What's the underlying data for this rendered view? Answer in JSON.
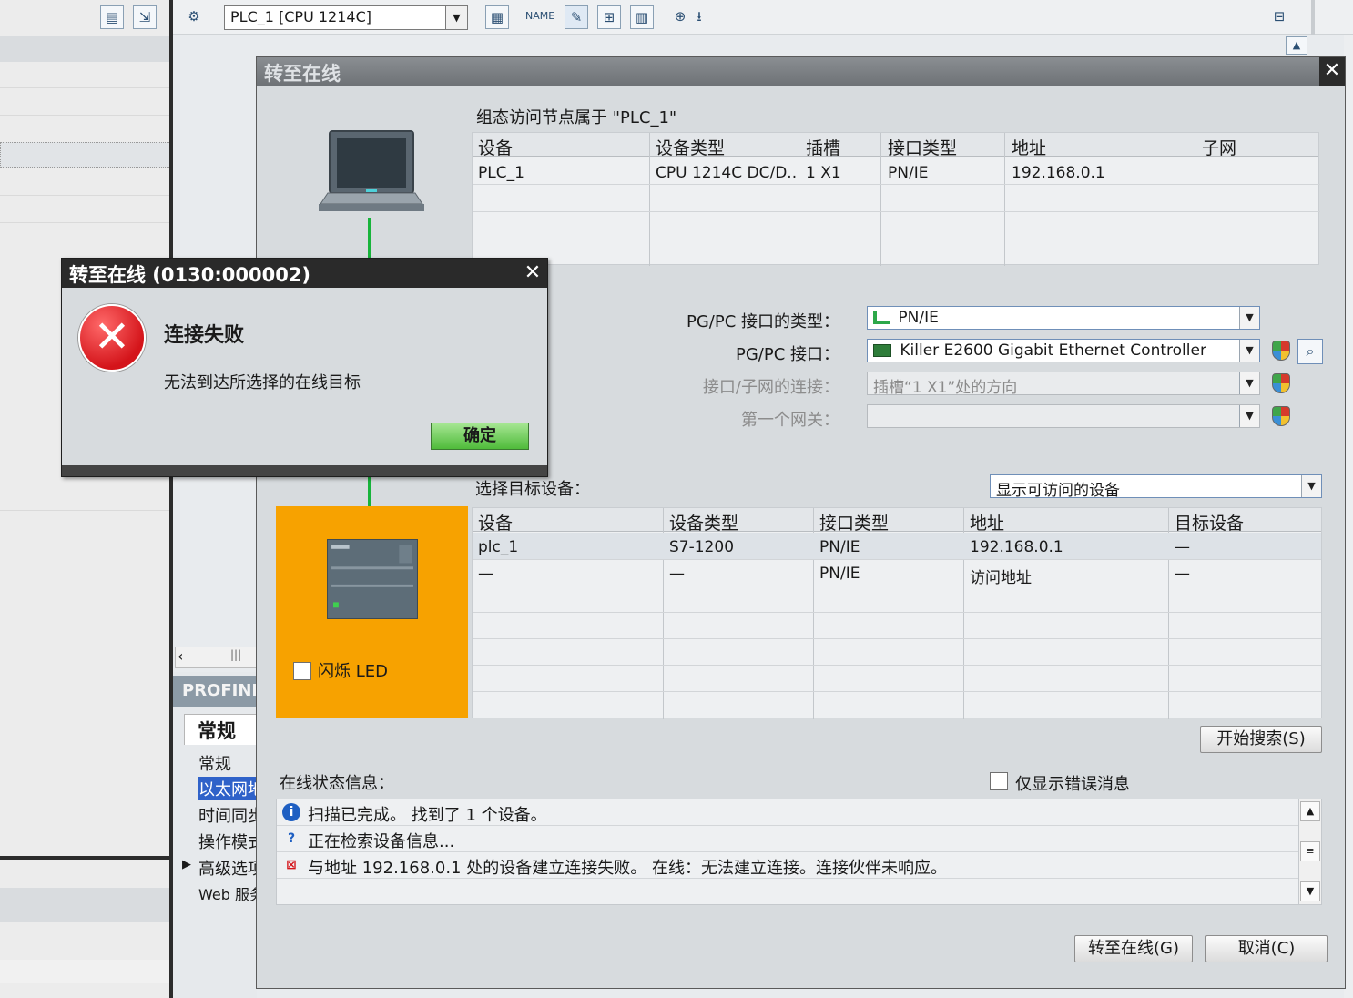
{
  "toolbar": {
    "device_select": "PLC_1 [CPU 1214C]"
  },
  "left_panel": {
    "profinet_header": "PROFINET",
    "general_tab": "常规",
    "nav_items": [
      "常规",
      "以太网地址",
      "时间同步",
      "操作模式",
      "高级选项",
      "Web 服务器"
    ]
  },
  "go_online": {
    "title": "转至在线",
    "config_node_label": "组态访问节点属于 \"PLC_1\"",
    "config_table": {
      "headers": [
        "设备",
        "设备类型",
        "插槽",
        "接口类型",
        "地址",
        "子网"
      ],
      "rows": [
        [
          "PLC_1",
          "CPU 1214C DC/D...",
          "1 X1",
          "PN/IE",
          "192.168.0.1",
          ""
        ]
      ]
    },
    "pgpc_type_label": "PG/PC 接口的类型：",
    "pgpc_type_value": "PN/IE",
    "pgpc_interface_label": "PG/PC 接口：",
    "pgpc_interface_value": "Killer E2600 Gigabit Ethernet Controller",
    "subnet_conn_label": "接口/子网的连接：",
    "subnet_conn_value": "插槽“1 X1”处的方向",
    "first_gateway_label": "第一个网关：",
    "first_gateway_value": "",
    "select_target_label": "选择目标设备：",
    "show_devices_value": "显示可访问的设备",
    "target_table": {
      "headers": [
        "设备",
        "设备类型",
        "接口类型",
        "地址",
        "目标设备"
      ],
      "rows": [
        [
          "plc_1",
          "S7-1200",
          "PN/IE",
          "192.168.0.1",
          "—"
        ],
        [
          "—",
          "—",
          "PN/IE",
          "访问地址",
          "—"
        ]
      ]
    },
    "flash_led_label": "闪烁 LED",
    "start_search_label": "开始搜索(S)",
    "online_status_label": "在线状态信息：",
    "only_errors_label": "仅显示错误消息",
    "status_messages": [
      "扫描已完成。 找到了 1 个设备。",
      "正在检索设备信息...",
      "与地址 192.168.0.1 处的设备建立连接失败。 在线：无法建立连接。连接伙伴未响应。"
    ],
    "go_online_button": "转至在线(G)",
    "cancel_button": "取消(C)"
  },
  "error_dialog": {
    "title": "转至在线 (0130:000002)",
    "heading": "连接失败",
    "message": "无法到达所选择的在线目标",
    "ok_button": "确定"
  },
  "colors": {
    "target_panel": "#f7a200",
    "link_line": "#18b43b",
    "error_red": "#d4141a",
    "ok_green": "#4fbb3a"
  }
}
